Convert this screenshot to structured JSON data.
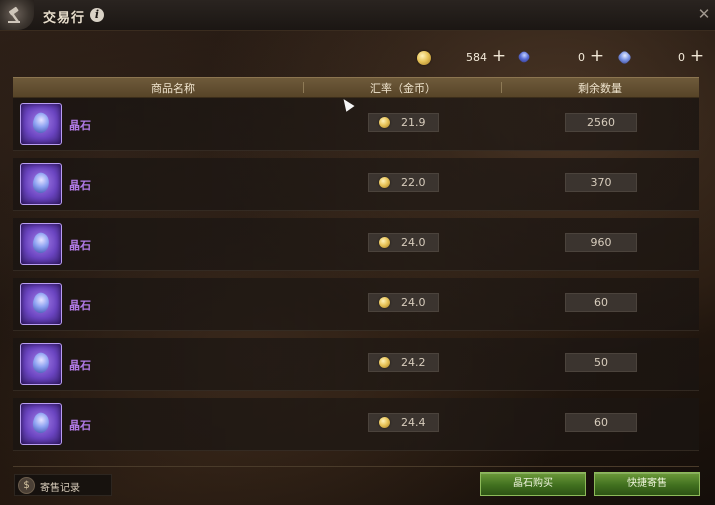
{
  "window": {
    "title": "交易行",
    "info_icon": "i",
    "close_icon": "✕"
  },
  "currencies": [
    {
      "icon": "gold-coin-icon",
      "amount": "584",
      "plus": "+"
    },
    {
      "icon": "blue-gem-icon",
      "amount": "0",
      "plus": "+"
    },
    {
      "icon": "crystal-gem-icon",
      "amount": "0",
      "plus": "+"
    }
  ],
  "table": {
    "headers": [
      "商品名称",
      "汇率（金币）",
      "剩余数量"
    ],
    "rows": [
      {
        "name": "晶石",
        "rate": "21.9",
        "qty": "2560"
      },
      {
        "name": "晶石",
        "rate": "22.0",
        "qty": "370"
      },
      {
        "name": "晶石",
        "rate": "24.0",
        "qty": "960"
      },
      {
        "name": "晶石",
        "rate": "24.0",
        "qty": "60"
      },
      {
        "name": "晶石",
        "rate": "24.2",
        "qty": "50"
      },
      {
        "name": "晶石",
        "rate": "24.4",
        "qty": "60"
      }
    ]
  },
  "footer": {
    "record_label": "寄售记录",
    "buy_button": "晶石购买",
    "sell_button": "快捷寄售"
  },
  "colors": {
    "item_name": "#b27be6",
    "button_green": "#41701f",
    "header_bar": "#6e5a3a"
  }
}
